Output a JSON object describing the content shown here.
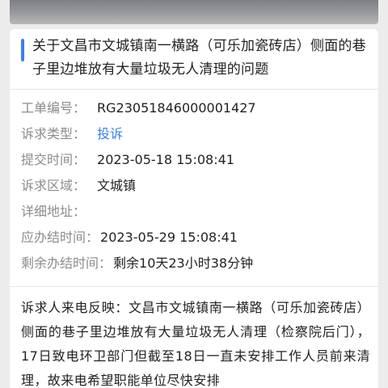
{
  "ticket": {
    "title": "关于文昌市文城镇南一横路（可乐加瓷砖店）侧面的巷子里边堆放有大量垃圾无人清理的问题",
    "fields": [
      {
        "label": "工单编号：",
        "value": "RG23051846000001427"
      },
      {
        "label": "诉求类型：",
        "value": "投诉"
      },
      {
        "label": "提交时间：",
        "value": "2023-05-18 15:08:41"
      },
      {
        "label": "诉求区域：",
        "value": "文城镇"
      },
      {
        "label": "详细地址：",
        "value": ""
      },
      {
        "label": "应办结时间：",
        "value": "2023-05-29 15:08:41"
      },
      {
        "label": "剩余办结时间：",
        "value": "剩余10天23小时38分钟"
      }
    ],
    "description": "诉求人来电反映：文昌市文城镇南一横路（可乐加瓷砖店）侧面的巷子里边堆放有大量垃圾无人清理（检察院后门），17日致电环卫部门但截至18日一直未安排工作人员前来清理，故来电希望职能单位尽快安排"
  },
  "colors": {
    "accent": "#3b7ff0",
    "label": "#8c8c8c",
    "text": "#222222",
    "background": "#ececec"
  }
}
